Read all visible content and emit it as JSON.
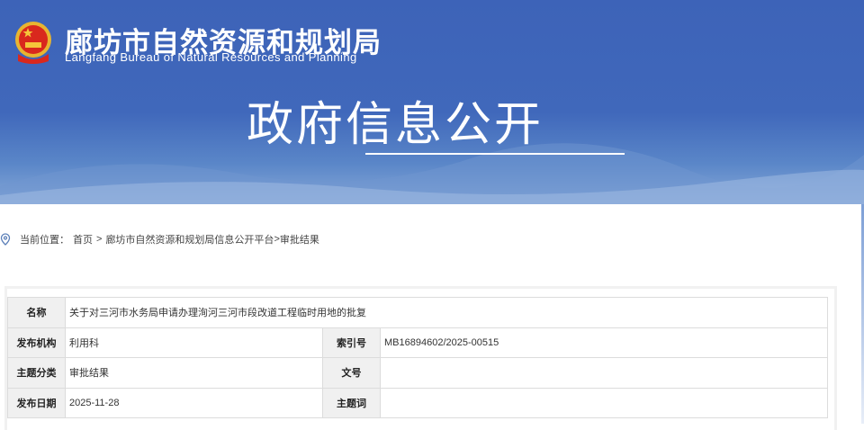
{
  "header": {
    "title_cn": "廊坊市自然资源和规划局",
    "title_en": "Langfang Bureau of Natural Resources and Planning",
    "hero": "政府信息公开"
  },
  "breadcrumb": {
    "prefix": "当前位置：",
    "home": "首页",
    "sep": ">",
    "platform": "廊坊市自然资源和规划局信息公开平台",
    "sep2": ">",
    "current": "审批结果"
  },
  "info": {
    "name_label": "名称",
    "name": "关于对三河市水务局申请办理洵河三河市段改道工程临时用地的批复",
    "org_label": "发布机构",
    "org": "利用科",
    "index_label": "索引号",
    "index": "MB16894602/2025-00515",
    "topic_label": "主题分类",
    "topic": "审批结果",
    "docno_label": "文号",
    "docno": "",
    "date_label": "发布日期",
    "date": "2025-11-28",
    "keyword_label": "主题词",
    "keyword": ""
  }
}
